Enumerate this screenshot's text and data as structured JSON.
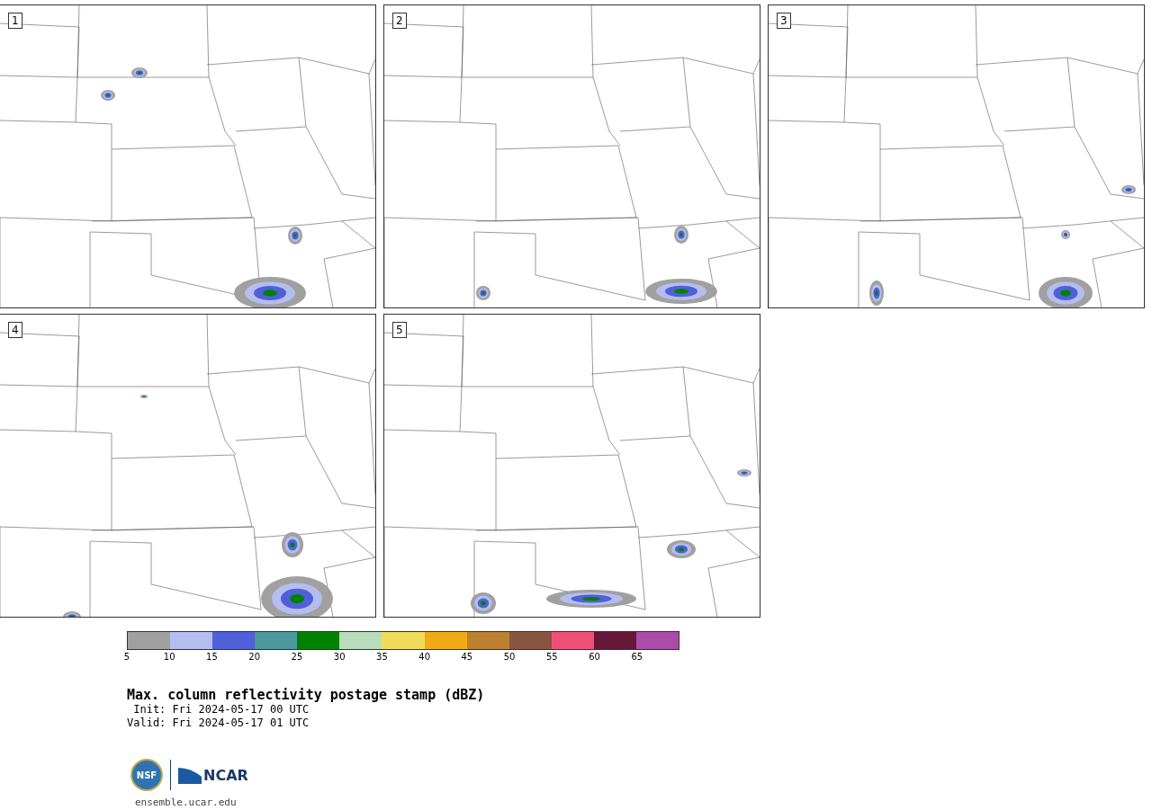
{
  "panels": [
    {
      "label": "1"
    },
    {
      "label": "2"
    },
    {
      "label": "3"
    },
    {
      "label": "4"
    },
    {
      "label": "5"
    }
  ],
  "legend": {
    "bins": [
      {
        "color": "#a0a0a0",
        "label": "5"
      },
      {
        "color": "#b4bdee",
        "label": "10"
      },
      {
        "color": "#5060d8",
        "label": "15"
      },
      {
        "color": "#4b979b",
        "label": "20"
      },
      {
        "color": "#008200",
        "label": "25"
      },
      {
        "color": "#b9dcbc",
        "label": "30"
      },
      {
        "color": "#f0dc5a",
        "label": "35"
      },
      {
        "color": "#f0aa14",
        "label": "40"
      },
      {
        "color": "#bb8030",
        "label": "45"
      },
      {
        "color": "#885540",
        "label": "50"
      },
      {
        "color": "#f05078",
        "label": "55"
      },
      {
        "color": "#661838",
        "label": "60"
      },
      {
        "color": "#aa4ca8",
        "label": "65"
      }
    ]
  },
  "title": "Max. column reflectivity postage stamp (dBZ)",
  "init": " Init: Fri 2024-05-17 00 UTC",
  "valid": "Valid: Fri 2024-05-17 01 UTC",
  "logo": {
    "seal": "NSF",
    "wordmark": "NCAR"
  },
  "url": "ensemble.ucar.edu"
}
